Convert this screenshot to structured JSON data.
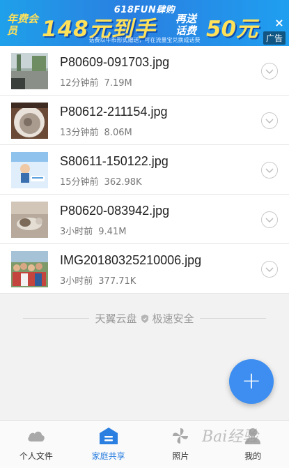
{
  "banner": {
    "top_title": "618FUN肆购",
    "left_small": "年费会员",
    "big_text": "148元到手",
    "mid_small": "再送话费",
    "big_text2": "50元",
    "note": "话费以牛币形式赠送，可在流量宝兑换成话费",
    "close_glyph": "×",
    "ad_label": "广告"
  },
  "files": [
    {
      "name": "P80609-091703.jpg",
      "time": "12分钟前",
      "size": "7.19M",
      "thumb": "street"
    },
    {
      "name": "P80612-211154.jpg",
      "time": "13分钟前",
      "size": "8.06M",
      "thumb": "bowl"
    },
    {
      "name": "S80611-150122.jpg",
      "time": "15分钟前",
      "size": "362.98K",
      "thumb": "poster"
    },
    {
      "name": "P80620-083942.jpg",
      "time": "3小时前",
      "size": "9.41M",
      "thumb": "cat"
    },
    {
      "name": "IMG20180325210006.jpg",
      "time": "3小时前",
      "size": "377.71K",
      "thumb": "group"
    }
  ],
  "brand": {
    "left": "天翼云盘",
    "right": "极速安全"
  },
  "fab": {
    "label": "+"
  },
  "nav": [
    {
      "label": "个人文件",
      "icon": "cloud-icon",
      "active": false
    },
    {
      "label": "家庭共享",
      "icon": "family-share-icon",
      "active": true
    },
    {
      "label": "照片",
      "icon": "pinwheel-icon",
      "active": false
    },
    {
      "label": "我的",
      "icon": "person-icon",
      "active": false
    }
  ],
  "watermark": "Bai经验",
  "colors": {
    "accent": "#2b7fe0",
    "fab": "#3d8ef0",
    "banner_yellow": "#ffe15a"
  }
}
